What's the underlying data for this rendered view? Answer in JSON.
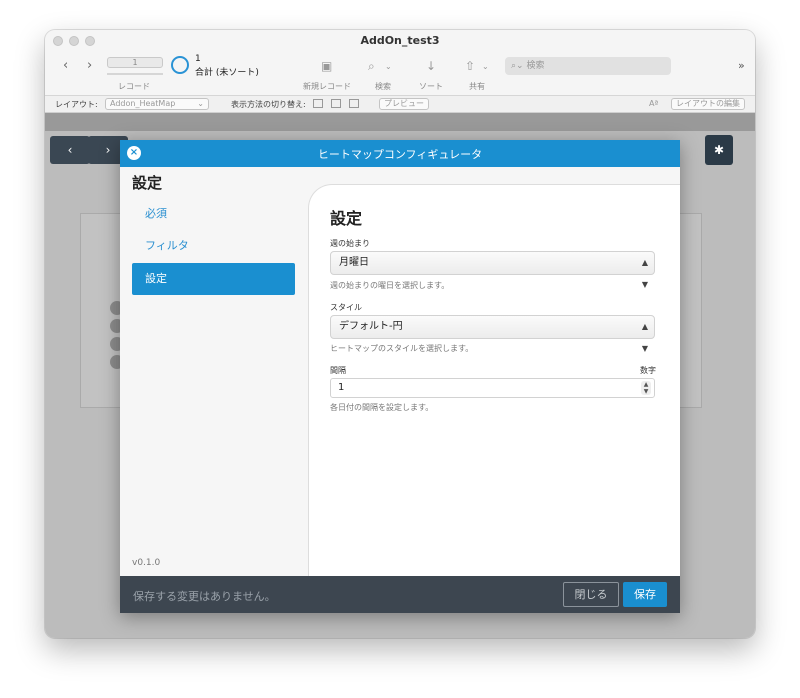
{
  "window": {
    "title": "AddOn_test3"
  },
  "toolbar": {
    "record_number": "1",
    "record_label": "レコード",
    "found_count": "1",
    "found_sub": "合計 (未ソート)",
    "new_record": "新規レコード",
    "find": "検索",
    "sort": "ソート",
    "share": "共有",
    "search_placeholder": "検索",
    "overflow": "»"
  },
  "layout_bar": {
    "layout_label": "レイアウト:",
    "layout_value": "Addon_HeatMap",
    "view_as_label": "表示方法の切り替え:",
    "preview_label": "プレビュー",
    "font_size_label": "Aª",
    "edit_layout_label": "レイアウトの編集"
  },
  "modal": {
    "title": "ヒートマップコンフィギュレータ",
    "sidebar": {
      "title": "設定",
      "items": [
        {
          "label": "必須"
        },
        {
          "label": "フィルタ"
        },
        {
          "label": "設定"
        }
      ],
      "version": "v0.1.0"
    },
    "main": {
      "title": "設定",
      "fields": {
        "week_start": {
          "label": "週の始まり",
          "value": "月曜日",
          "help": "週の始まりの曜日を選択します。"
        },
        "style": {
          "label": "スタイル",
          "value": "デフォルト-円",
          "help": "ヒートマップのスタイルを選択します。"
        },
        "interval": {
          "label": "間隔",
          "type_label": "数字",
          "value": "1",
          "help": "各日付の間隔を設定します。"
        }
      }
    },
    "footer": {
      "status": "保存する変更はありません。",
      "close_label": "閉じる",
      "save_label": "保存"
    }
  }
}
